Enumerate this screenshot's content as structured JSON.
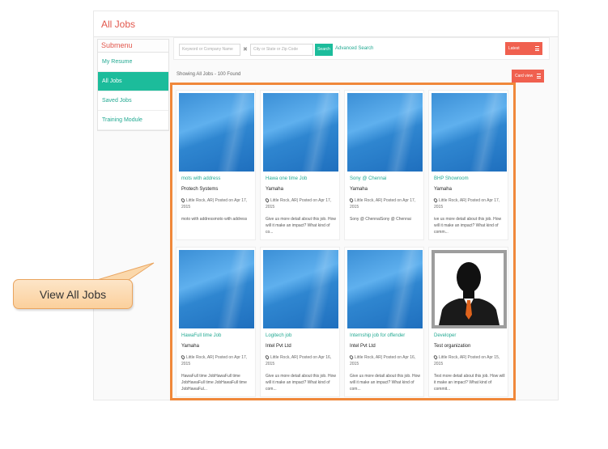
{
  "header": {
    "title": "All Jobs"
  },
  "sidebar": {
    "heading": "Submenu",
    "items": [
      {
        "label": "My Resume",
        "active": false
      },
      {
        "label": "All Jobs",
        "active": true
      },
      {
        "label": "Saved Jobs",
        "active": false
      },
      {
        "label": "Training Module",
        "active": false
      }
    ]
  },
  "search": {
    "keyword_placeholder": "Keyword or Company Name",
    "location_placeholder": "City or State or Zip Code",
    "separator": "✖",
    "button_label": "Search",
    "advanced_label": "Advanced Search",
    "sort_label": "Latest"
  },
  "results": {
    "summary": "Showing All Jobs - 100 Found",
    "view_label": "Card view"
  },
  "jobs": [
    {
      "title": "mots with address",
      "company": "Protech Systems",
      "meta": "Little Rock, AR| Posted on Apr 17, 2015",
      "desc": "moto with addressmoto with address",
      "image": "blue-placeholder"
    },
    {
      "title": "Hawa one time Job",
      "company": "Yamaha",
      "meta": "Little Rock, AR| Posted on Apr 17, 2015",
      "desc": "Give us more detail about this job. How will it make an impact? What kind of co...",
      "image": "blue-placeholder"
    },
    {
      "title": "Sony @ Chennai",
      "company": "Yamaha",
      "meta": "Little Rock, AR| Posted on Apr 17, 2015",
      "desc": "Sony @ ChennaiSony @ Chennai",
      "image": "blue-placeholder"
    },
    {
      "title": "BHP Showroom",
      "company": "Yamaha",
      "meta": "Little Rock, AR| Posted on Apr 17, 2015",
      "desc": "ive us more detail about this job. How will it make an impact? What kind of comm...",
      "image": "blue-placeholder"
    },
    {
      "title": "HawaFull time Job",
      "company": "Yamaha",
      "meta": "Little Rock, AR| Posted on Apr 17, 2015",
      "desc": "HawaFull time JobHawaFull time JobHawaFull time JobHawaFull time JobHawaFul...",
      "image": "blue-placeholder"
    },
    {
      "title": "Logitech job",
      "company": "Intel Pvt Ltd",
      "meta": "Little Rock, AR| Posted on Apr 16, 2015",
      "desc": "Give us more detail about this job. How will it make an impact? What kind of com...",
      "image": "blue-placeholder"
    },
    {
      "title": "Internship job for offender",
      "company": "Intel Pvt Ltd",
      "meta": "Little Rock, AR| Posted on Apr 16, 2015",
      "desc": "Give us more detail about this job. How will it make an impact? What kind of com...",
      "image": "blue-placeholder"
    },
    {
      "title": "Developer",
      "company": "Test organization",
      "meta": "Little Rock, AR| Posted on Apr 15, 2015",
      "desc": "Test more detail about this job. How will it make an impact? What kind of commit...",
      "image": "avatar-silhouette"
    }
  ],
  "annotation": {
    "label": "View All Jobs"
  },
  "colors": {
    "accent": "#1cbc9b",
    "action": "#f0604f",
    "title": "#e2574c",
    "highlight": "#f0883a"
  }
}
